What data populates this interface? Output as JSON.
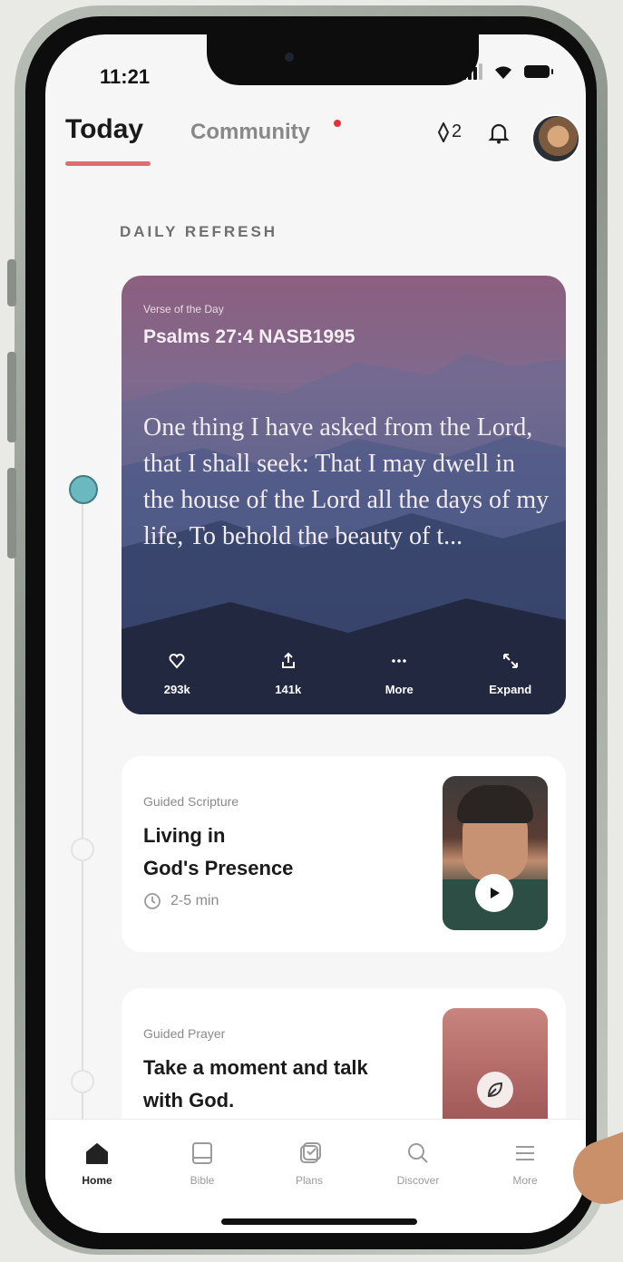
{
  "status": {
    "time": "11:21"
  },
  "header": {
    "tabs": [
      {
        "label": "Today",
        "active": true
      },
      {
        "label": "Community",
        "has_notification": true
      }
    ],
    "streak_count": "2"
  },
  "section_label": "DAILY REFRESH",
  "verse_card": {
    "kicker": "Verse of the Day",
    "reference": "Psalms 27:4 NASB1995",
    "text": "One thing I have asked from the Lord, that I shall seek: That I may dwell in the house of the Lord all the days of my life, To behold the beauty of t...",
    "actions": [
      {
        "icon": "heart-icon",
        "label": "293k"
      },
      {
        "icon": "share-icon",
        "label": "141k"
      },
      {
        "icon": "more-icon",
        "label": "More"
      },
      {
        "icon": "expand-icon",
        "label": "Expand"
      }
    ]
  },
  "guided_scripture": {
    "kicker": "Guided Scripture",
    "title_line1": "Living in",
    "title_line2": "God's Presence",
    "duration": "2-5 min"
  },
  "guided_prayer": {
    "kicker": "Guided Prayer",
    "title_line1": "Take a moment and talk",
    "title_line2": "with God."
  },
  "bottom_nav": [
    {
      "label": "Home",
      "icon": "home-icon",
      "active": true
    },
    {
      "label": "Bible",
      "icon": "bible-icon"
    },
    {
      "label": "Plans",
      "icon": "plans-icon"
    },
    {
      "label": "Discover",
      "icon": "search-icon"
    },
    {
      "label": "More",
      "icon": "menu-icon"
    }
  ],
  "colors": {
    "accent": "#e46a6f",
    "timeline_dot": "#6bb8c0",
    "notification": "#e2343b"
  }
}
